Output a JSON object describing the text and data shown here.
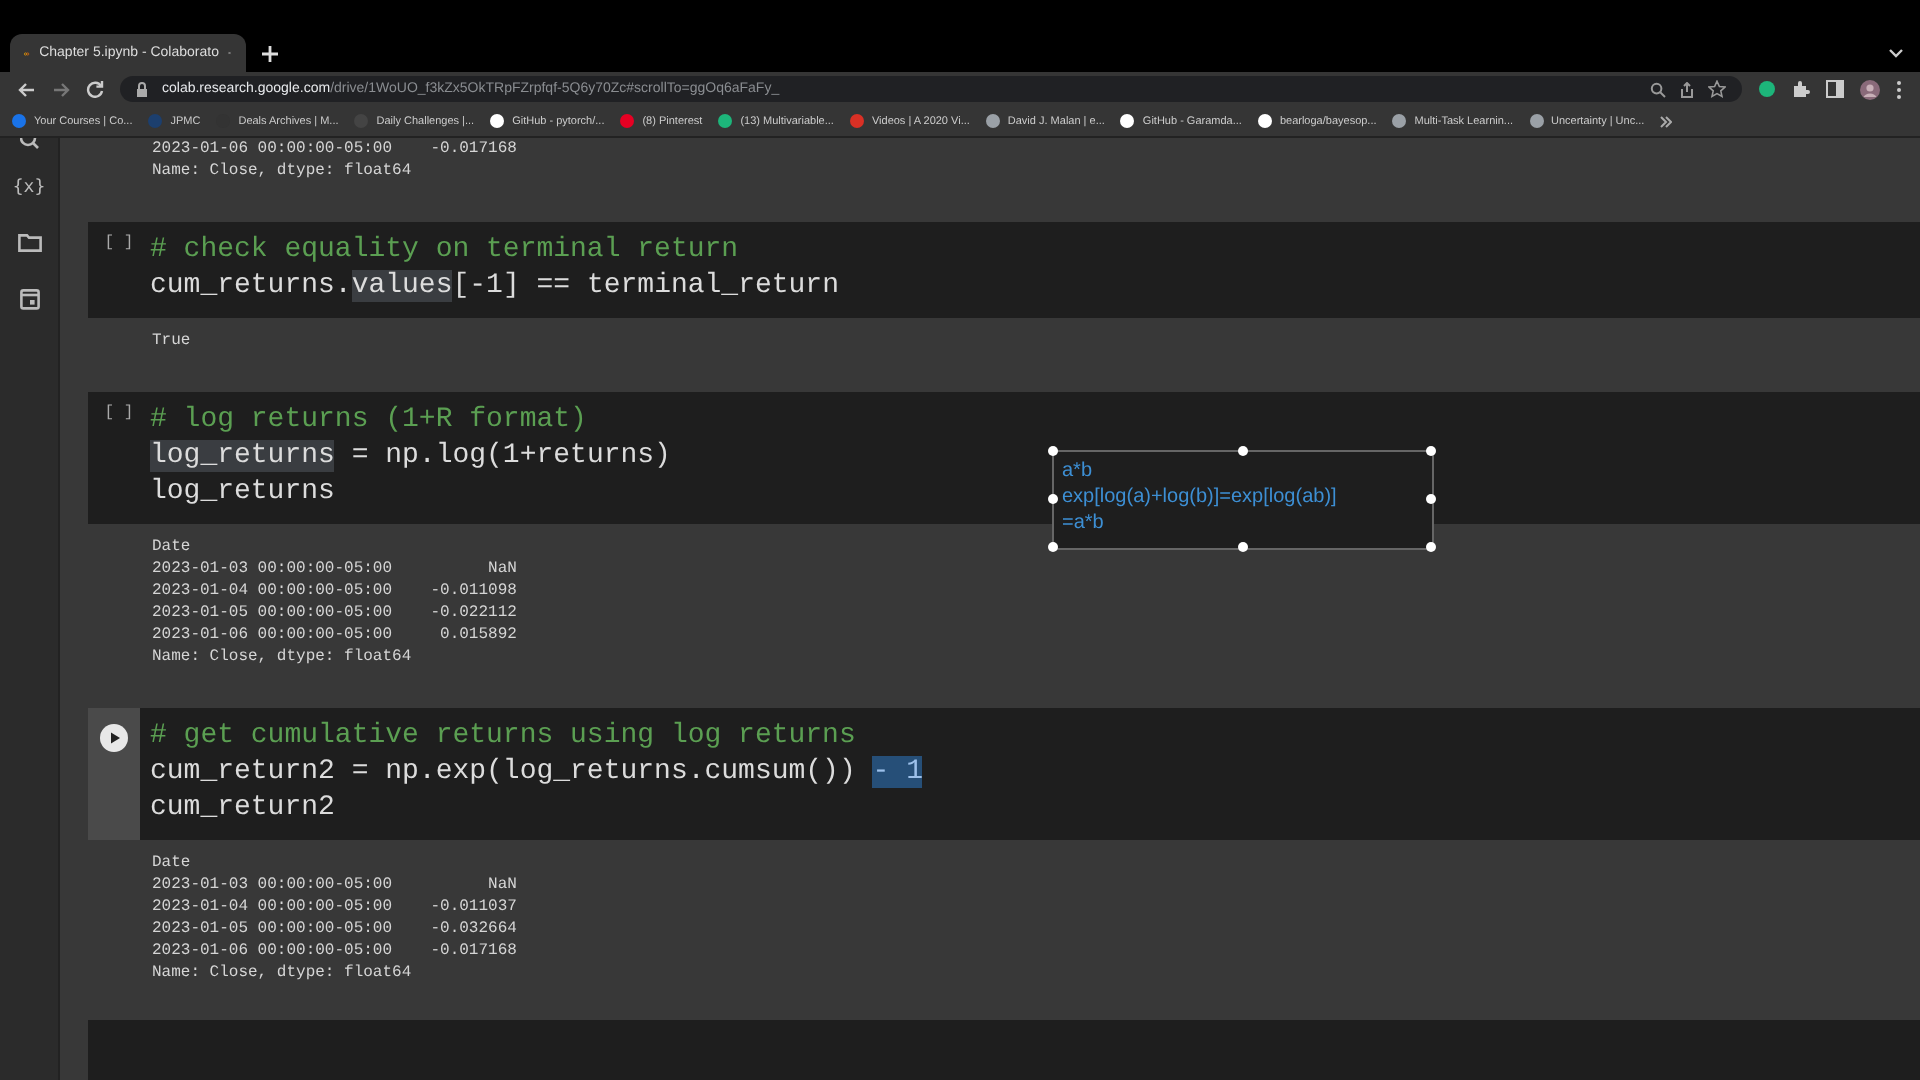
{
  "browser": {
    "tabs": [
      {
        "title": "Chapter 5.ipynb - Colaborato",
        "selected": true
      }
    ],
    "url": {
      "host": "colab.research.google.com",
      "path": "/drive/1WoUO_f3kZx5OkTRpFZrpfqf-5Q6y70Zc#scrollTo=ggOq6aFaFy_"
    },
    "bookmarks": [
      {
        "label": "Your Courses | Co...",
        "color": "#1a73e8"
      },
      {
        "label": "JPMC",
        "color": "#1c3f6e"
      },
      {
        "label": "Deals Archives | M...",
        "color": "#333333"
      },
      {
        "label": "Daily Challenges |...",
        "color": "#444444"
      },
      {
        "label": "GitHub - pytorch/...",
        "color": "#ffffff"
      },
      {
        "label": "(8) Pinterest",
        "color": "#e60023"
      },
      {
        "label": "(13) Multivariable...",
        "color": "#1db57a"
      },
      {
        "label": "Videos | A 2020 Vi...",
        "color": "#d93025"
      },
      {
        "label": "David J. Malan | e...",
        "color": "#9aa0a6"
      },
      {
        "label": "GitHub - Garamda...",
        "color": "#ffffff"
      },
      {
        "label": "bearloga/bayesop...",
        "color": "#ffffff"
      },
      {
        "label": "Multi-Task Learnin...",
        "color": "#9aa0a6"
      },
      {
        "label": "Uncertainty | Unc...",
        "color": "#9aa0a6"
      }
    ]
  },
  "sidebar": {
    "variables_label": "{x}"
  },
  "top_output": [
    "2023-01-06 00:00:00-05:00    -0.017168",
    "Name: Close, dtype: float64"
  ],
  "cells": [
    {
      "focused": false,
      "bracket": "[ ]",
      "lines": [
        [
          {
            "text": "# check equality on terminal return",
            "kind": "comment"
          }
        ],
        [
          {
            "text": "cum_returns.",
            "kind": "code"
          },
          {
            "text": "values",
            "kind": "hover"
          },
          {
            "text": "[-1] == terminal_return",
            "kind": "code"
          }
        ]
      ],
      "output": [
        "True"
      ]
    },
    {
      "focused": false,
      "bracket": "[ ]",
      "lines": [
        [
          {
            "text": "# log returns (1+R format)",
            "kind": "comment"
          }
        ],
        [
          {
            "text": "log_returns",
            "kind": "hover"
          },
          {
            "text": " = np.log(1+returns)",
            "kind": "code"
          }
        ],
        [
          {
            "text": "log_returns",
            "kind": "code"
          }
        ]
      ],
      "output": [
        "Date",
        "2023-01-03 00:00:00-05:00          NaN",
        "2023-01-04 00:00:00-05:00    -0.011098",
        "2023-01-05 00:00:00-05:00    -0.022112",
        "2023-01-06 00:00:00-05:00     0.015892",
        "Name: Close, dtype: float64"
      ]
    },
    {
      "focused": true,
      "lines": [
        [
          {
            "text": "# get cumulative returns using log returns",
            "kind": "comment"
          }
        ],
        [
          {
            "text": "cum_return2 = np.exp(log_returns.cumsum()) ",
            "kind": "code"
          },
          {
            "text": "- 1",
            "kind": "selection"
          }
        ],
        [
          {
            "text": "cum_return2",
            "kind": "code"
          }
        ]
      ],
      "output": [
        "Date",
        "2023-01-03 00:00:00-05:00          NaN",
        "2023-01-04 00:00:00-05:00    -0.011037",
        "2023-01-05 00:00:00-05:00    -0.032664",
        "2023-01-06 00:00:00-05:00    -0.017168",
        "Name: Close, dtype: float64"
      ]
    }
  ],
  "annotation": {
    "lines": [
      "a*b",
      "exp[log(a)+log(b)]=exp[log(ab)]",
      "=a*b"
    ]
  }
}
